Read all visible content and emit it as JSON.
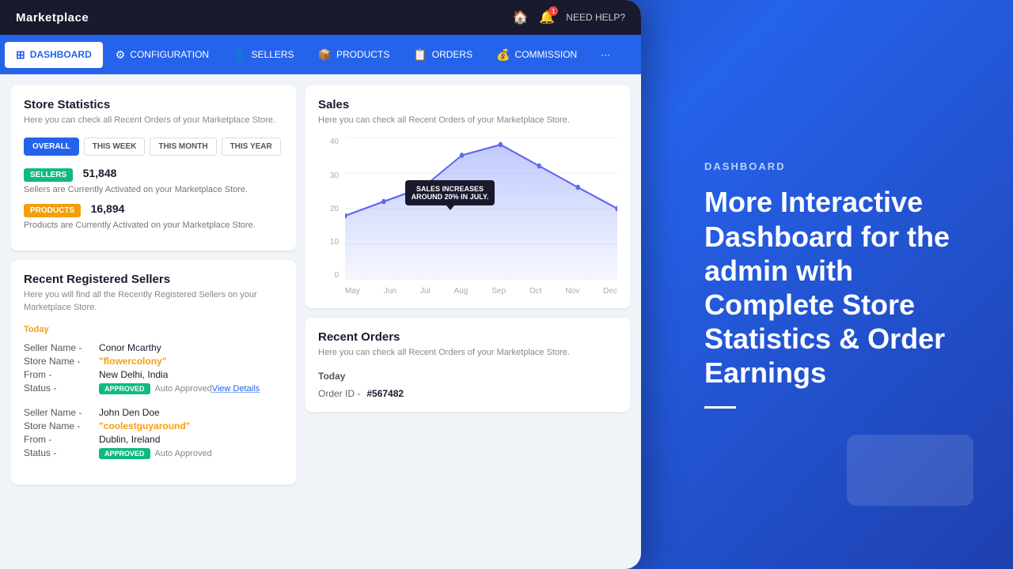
{
  "app": {
    "title": "Marketplace",
    "need_help": "NEED HELP?"
  },
  "nav": {
    "items": [
      {
        "id": "dashboard",
        "label": "DASHBOARD",
        "icon": "⊞",
        "active": true
      },
      {
        "id": "configuration",
        "label": "CONFIGURATION",
        "icon": "⚙"
      },
      {
        "id": "sellers",
        "label": "SELLERS",
        "icon": "👤"
      },
      {
        "id": "products",
        "label": "PRODUCTS",
        "icon": "📦"
      },
      {
        "id": "orders",
        "label": "ORDERS",
        "icon": "📋"
      },
      {
        "id": "commission",
        "label": "COMMISSION",
        "icon": "💰"
      },
      {
        "id": "more",
        "label": "···",
        "icon": ""
      }
    ]
  },
  "store_statistics": {
    "title": "Store Statistics",
    "subtitle": "Here you can check all Recent Orders of your Marketplace Store.",
    "tabs": [
      "OVERALL",
      "THIS WEEK",
      "THIS MONTH",
      "THIS YEAR"
    ],
    "active_tab": "OVERALL",
    "sellers": {
      "badge": "SELLERS",
      "count": "51,848",
      "desc": "Sellers are Currently Activated on your Marketplace Store."
    },
    "products": {
      "badge": "PRODUCTS",
      "count": "16,894",
      "desc": "Products are Currently Activated on your Marketplace Store."
    }
  },
  "recent_sellers": {
    "title": "Recent Registered Sellers",
    "subtitle": "Here you will find all the Recently Registered Sellers on your Marketplace Store.",
    "section_label": "Today",
    "sellers": [
      {
        "seller_name_label": "Seller Name -",
        "seller_name": "Conor Mcarthy",
        "store_name_label": "Store Name -",
        "store_name": "\"flowercolony\"",
        "from_label": "From -",
        "from": "New Delhi, India",
        "status_label": "Status -",
        "status": "APPROVED",
        "auto": "Auto Approved",
        "view_details": "View Details"
      },
      {
        "seller_name_label": "Seller Name -",
        "seller_name": "John Den Doe",
        "store_name_label": "Store Name -",
        "store_name": "\"coolestguyaround\"",
        "from_label": "From -",
        "from": "Dublin, Ireland",
        "status_label": "Status -",
        "status": "APPROVED",
        "auto": "Auto Approved"
      }
    ]
  },
  "sales": {
    "title": "Sales",
    "subtitle": "Here you can check all Recent Orders of your Marketplace Store.",
    "tooltip": "SALES INCREASES\nAROUND 20% IN JULY.",
    "y_labels": [
      "40",
      "30",
      "20",
      "10",
      "0"
    ],
    "x_labels": [
      "May",
      "Jun",
      "Jul",
      "Aug",
      "Sep",
      "Oct",
      "Nov",
      "Dec"
    ],
    "chart_data": [
      18,
      22,
      26,
      35,
      38,
      32,
      26,
      20
    ]
  },
  "recent_orders": {
    "title": "Recent Orders",
    "subtitle": "Here you can check all Recent Orders of your Marketplace Store.",
    "section_label": "Today",
    "order_id_label": "Order ID -",
    "order_id": "#567482"
  },
  "right_panel": {
    "label": "DASHBOARD",
    "heading": "More Interactive Dashboard for the admin with Complete Store Statistics & Order Earnings"
  }
}
